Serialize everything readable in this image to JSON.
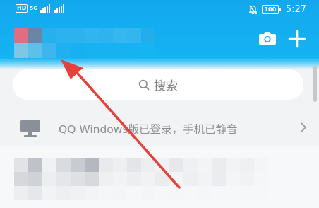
{
  "status_bar": {
    "left_badge": "HD",
    "network_5g": "5G",
    "battery_level": "100",
    "time": "5:27",
    "icons": [
      "hd-icon",
      "signal-icon",
      "signal-icon",
      "mute-icon",
      "battery-icon"
    ]
  },
  "header": {
    "profile": "pixelated-avatar-and-name",
    "actions": [
      "camera-icon",
      "plus-icon"
    ],
    "colors": {
      "header_top": "#13a8ee",
      "header_bottom": "#15b6f3"
    }
  },
  "search": {
    "placeholder": "搜索",
    "icon": "search-icon"
  },
  "device_notice": {
    "text": "QQ Windows版已登录，手机已静音",
    "icon": "monitor-icon",
    "trailing_icon": "chevron-right-icon"
  },
  "annotation": {
    "arrow_color": "#e8403a",
    "icon": "red-arrow"
  }
}
